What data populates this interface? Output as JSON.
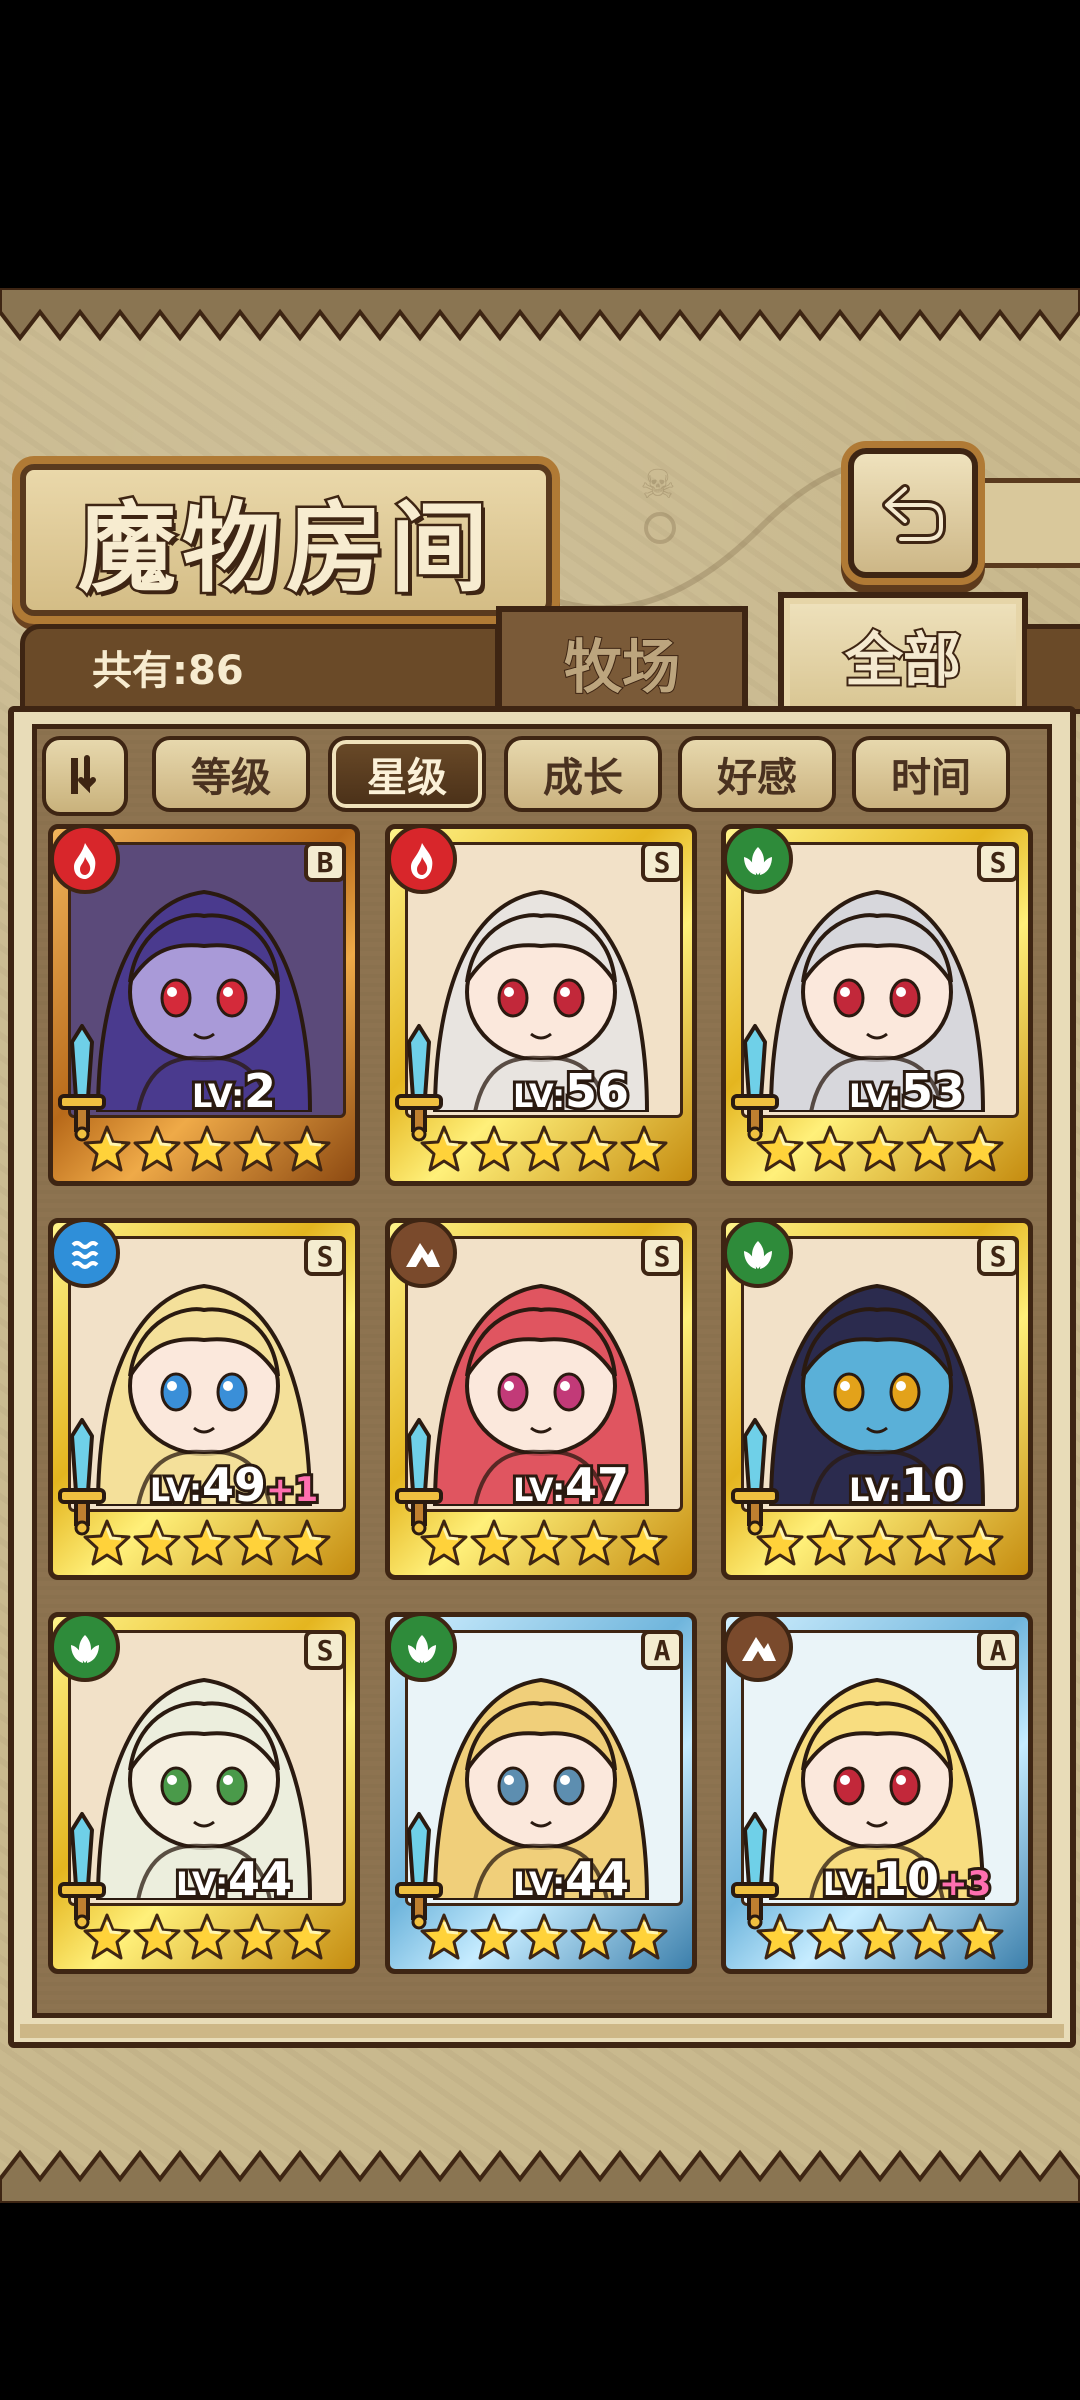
{
  "title": "魔物房间",
  "count_label": "共有:86",
  "tabs": {
    "ranch": "牧场",
    "all": "全部"
  },
  "filters": [
    {
      "label": "等级",
      "active": false
    },
    {
      "label": "星级",
      "active": true
    },
    {
      "label": "成长",
      "active": false
    },
    {
      "label": "好感",
      "active": false
    },
    {
      "label": "时间",
      "active": false
    }
  ],
  "colors": {
    "fire": "#d8262b",
    "nature": "#2e8b3a",
    "water": "#2f8fd9",
    "earth": "#7a4a2c"
  },
  "cards": [
    {
      "rank": "B",
      "element": "fire",
      "frame": "bronze",
      "lv_prefix": "LV:",
      "lv": "2",
      "bonus": "",
      "stars": 5
    },
    {
      "rank": "S",
      "element": "fire",
      "frame": "gold",
      "lv_prefix": "LV:",
      "lv": "56",
      "bonus": "",
      "stars": 5
    },
    {
      "rank": "S",
      "element": "nature",
      "frame": "gold",
      "lv_prefix": "LV:",
      "lv": "53",
      "bonus": "",
      "stars": 5
    },
    {
      "rank": "S",
      "element": "water",
      "frame": "gold",
      "lv_prefix": "LV:",
      "lv": "49",
      "bonus": "+1",
      "stars": 5
    },
    {
      "rank": "S",
      "element": "earth",
      "frame": "gold",
      "lv_prefix": "LV:",
      "lv": "47",
      "bonus": "",
      "stars": 5
    },
    {
      "rank": "S",
      "element": "nature",
      "frame": "gold",
      "lv_prefix": "LV:",
      "lv": "10",
      "bonus": "",
      "stars": 5
    },
    {
      "rank": "S",
      "element": "nature",
      "frame": "gold",
      "lv_prefix": "LV:",
      "lv": "44",
      "bonus": "",
      "stars": 5
    },
    {
      "rank": "A",
      "element": "nature",
      "frame": "blue",
      "lv_prefix": "LV:",
      "lv": "44",
      "bonus": "",
      "stars": 5
    },
    {
      "rank": "A",
      "element": "earth",
      "frame": "blue",
      "lv_prefix": "LV:",
      "lv": "10",
      "bonus": "+3",
      "stars": 5
    }
  ]
}
